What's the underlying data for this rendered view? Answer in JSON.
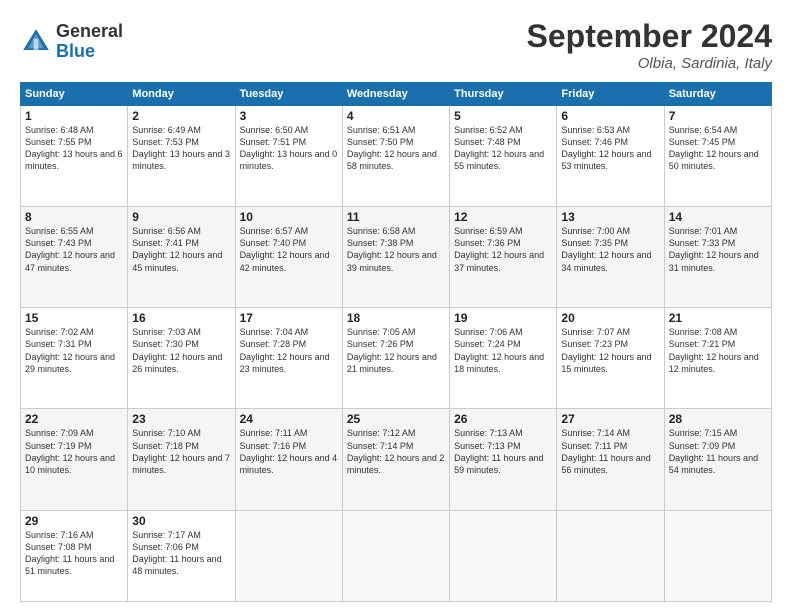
{
  "header": {
    "logo_general": "General",
    "logo_blue": "Blue",
    "month_title": "September 2024",
    "location": "Olbia, Sardinia, Italy"
  },
  "days_of_week": [
    "Sunday",
    "Monday",
    "Tuesday",
    "Wednesday",
    "Thursday",
    "Friday",
    "Saturday"
  ],
  "weeks": [
    [
      {
        "day": 1,
        "sunrise": "6:48 AM",
        "sunset": "7:55 PM",
        "daylight": "13 hours and 6 minutes."
      },
      {
        "day": 2,
        "sunrise": "6:49 AM",
        "sunset": "7:53 PM",
        "daylight": "13 hours and 3 minutes."
      },
      {
        "day": 3,
        "sunrise": "6:50 AM",
        "sunset": "7:51 PM",
        "daylight": "13 hours and 0 minutes."
      },
      {
        "day": 4,
        "sunrise": "6:51 AM",
        "sunset": "7:50 PM",
        "daylight": "12 hours and 58 minutes."
      },
      {
        "day": 5,
        "sunrise": "6:52 AM",
        "sunset": "7:48 PM",
        "daylight": "12 hours and 55 minutes."
      },
      {
        "day": 6,
        "sunrise": "6:53 AM",
        "sunset": "7:46 PM",
        "daylight": "12 hours and 53 minutes."
      },
      {
        "day": 7,
        "sunrise": "6:54 AM",
        "sunset": "7:45 PM",
        "daylight": "12 hours and 50 minutes."
      }
    ],
    [
      {
        "day": 8,
        "sunrise": "6:55 AM",
        "sunset": "7:43 PM",
        "daylight": "12 hours and 47 minutes."
      },
      {
        "day": 9,
        "sunrise": "6:56 AM",
        "sunset": "7:41 PM",
        "daylight": "12 hours and 45 minutes."
      },
      {
        "day": 10,
        "sunrise": "6:57 AM",
        "sunset": "7:40 PM",
        "daylight": "12 hours and 42 minutes."
      },
      {
        "day": 11,
        "sunrise": "6:58 AM",
        "sunset": "7:38 PM",
        "daylight": "12 hours and 39 minutes."
      },
      {
        "day": 12,
        "sunrise": "6:59 AM",
        "sunset": "7:36 PM",
        "daylight": "12 hours and 37 minutes."
      },
      {
        "day": 13,
        "sunrise": "7:00 AM",
        "sunset": "7:35 PM",
        "daylight": "12 hours and 34 minutes."
      },
      {
        "day": 14,
        "sunrise": "7:01 AM",
        "sunset": "7:33 PM",
        "daylight": "12 hours and 31 minutes."
      }
    ],
    [
      {
        "day": 15,
        "sunrise": "7:02 AM",
        "sunset": "7:31 PM",
        "daylight": "12 hours and 29 minutes."
      },
      {
        "day": 16,
        "sunrise": "7:03 AM",
        "sunset": "7:30 PM",
        "daylight": "12 hours and 26 minutes."
      },
      {
        "day": 17,
        "sunrise": "7:04 AM",
        "sunset": "7:28 PM",
        "daylight": "12 hours and 23 minutes."
      },
      {
        "day": 18,
        "sunrise": "7:05 AM",
        "sunset": "7:26 PM",
        "daylight": "12 hours and 21 minutes."
      },
      {
        "day": 19,
        "sunrise": "7:06 AM",
        "sunset": "7:24 PM",
        "daylight": "12 hours and 18 minutes."
      },
      {
        "day": 20,
        "sunrise": "7:07 AM",
        "sunset": "7:23 PM",
        "daylight": "12 hours and 15 minutes."
      },
      {
        "day": 21,
        "sunrise": "7:08 AM",
        "sunset": "7:21 PM",
        "daylight": "12 hours and 12 minutes."
      }
    ],
    [
      {
        "day": 22,
        "sunrise": "7:09 AM",
        "sunset": "7:19 PM",
        "daylight": "12 hours and 10 minutes."
      },
      {
        "day": 23,
        "sunrise": "7:10 AM",
        "sunset": "7:18 PM",
        "daylight": "12 hours and 7 minutes."
      },
      {
        "day": 24,
        "sunrise": "7:11 AM",
        "sunset": "7:16 PM",
        "daylight": "12 hours and 4 minutes."
      },
      {
        "day": 25,
        "sunrise": "7:12 AM",
        "sunset": "7:14 PM",
        "daylight": "12 hours and 2 minutes."
      },
      {
        "day": 26,
        "sunrise": "7:13 AM",
        "sunset": "7:13 PM",
        "daylight": "11 hours and 59 minutes."
      },
      {
        "day": 27,
        "sunrise": "7:14 AM",
        "sunset": "7:11 PM",
        "daylight": "11 hours and 56 minutes."
      },
      {
        "day": 28,
        "sunrise": "7:15 AM",
        "sunset": "7:09 PM",
        "daylight": "11 hours and 54 minutes."
      }
    ],
    [
      {
        "day": 29,
        "sunrise": "7:16 AM",
        "sunset": "7:08 PM",
        "daylight": "11 hours and 51 minutes."
      },
      {
        "day": 30,
        "sunrise": "7:17 AM",
        "sunset": "7:06 PM",
        "daylight": "11 hours and 48 minutes."
      },
      null,
      null,
      null,
      null,
      null
    ]
  ],
  "labels": {
    "sunrise": "Sunrise:",
    "sunset": "Sunset:",
    "daylight": "Daylight:"
  }
}
